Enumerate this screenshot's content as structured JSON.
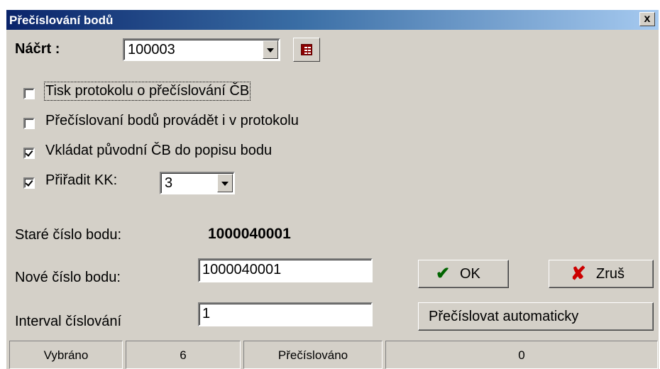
{
  "window": {
    "title": "Přečíslování bodů",
    "close_label": "x"
  },
  "sketch": {
    "label": "Náčrt :",
    "value": "100003",
    "grid_icon": "table-grid-icon"
  },
  "options": [
    {
      "label": "Tisk protokolu o přečíslování ČB",
      "checked": false
    },
    {
      "label": "Přečíslovaní bodů provádět i v protokolu",
      "checked": false
    },
    {
      "label": "Vkládat původní ČB do popisu bodu",
      "checked": true
    },
    {
      "label": "Přiřadit KK:",
      "checked": true
    }
  ],
  "kk_select": {
    "value": "3"
  },
  "old_number": {
    "label": "Staré číslo bodu:",
    "value": "1000040001"
  },
  "new_number": {
    "label": "Nové číslo bodu:",
    "value": "1000040001"
  },
  "interval": {
    "label": "Interval číslování",
    "value": "1"
  },
  "buttons": {
    "ok": "OK",
    "cancel": "Zruš",
    "auto": "Přečíslovat automaticky"
  },
  "status": {
    "selected_label": "Vybráno",
    "selected_count": "6",
    "renumbered_label": "Přečíslováno",
    "renumbered_count": "0"
  }
}
